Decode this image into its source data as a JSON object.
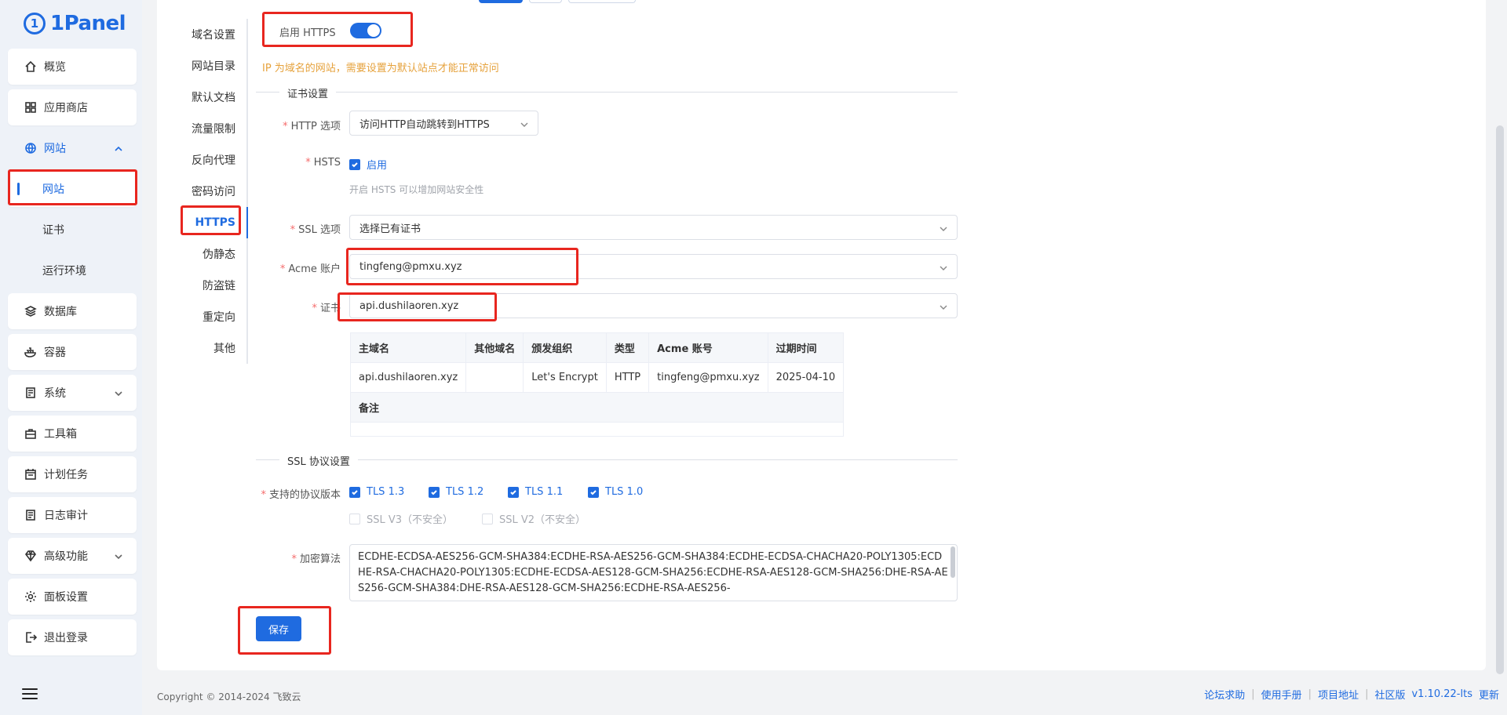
{
  "app": {
    "logo_text": "1Panel",
    "logo_mark": "1"
  },
  "sidebar": {
    "items": [
      {
        "label": "概览",
        "icon": "home-icon"
      },
      {
        "label": "应用商店",
        "icon": "grid-icon"
      },
      {
        "label": "网站",
        "icon": "globe-icon"
      },
      {
        "label": "网站"
      },
      {
        "label": "证书"
      },
      {
        "label": "运行环境"
      },
      {
        "label": "数据库",
        "icon": "layers-icon"
      },
      {
        "label": "容器",
        "icon": "docker-icon"
      },
      {
        "label": "系统",
        "icon": "server-icon"
      },
      {
        "label": "工具箱",
        "icon": "toolbox-icon"
      },
      {
        "label": "计划任务",
        "icon": "calendar-icon"
      },
      {
        "label": "日志审计",
        "icon": "log-icon"
      },
      {
        "label": "高级功能",
        "icon": "diamond-icon"
      },
      {
        "label": "面板设置",
        "icon": "gear-icon"
      },
      {
        "label": "退出登录",
        "icon": "logout-icon"
      }
    ]
  },
  "subnav": {
    "items": [
      "域名设置",
      "网站目录",
      "默认文档",
      "流量限制",
      "反向代理",
      "密码访问",
      "HTTPS",
      "伪静态",
      "防盗链",
      "重定向",
      "其他"
    ]
  },
  "https": {
    "enable_label": "启用 HTTPS",
    "ip_tip": "IP 为域名的网站，需要设置为默认站点才能正常访问",
    "cert_section": "证书设置",
    "http_option_label": "HTTP 选项",
    "http_option_value": "访问HTTP自动跳转到HTTPS",
    "hsts_label": "HSTS",
    "hsts_check": "启用",
    "hsts_hint": "开启 HSTS 可以增加网站安全性",
    "ssl_option_label": "SSL 选项",
    "ssl_option_value": "选择已有证书",
    "acme_label": "Acme 账户",
    "acme_value": "tingfeng@pmxu.xyz",
    "cert_label": "证书",
    "cert_value": "api.dushilaoren.xyz",
    "table": {
      "headers": [
        "主域名",
        "其他域名",
        "颁发组织",
        "类型",
        "Acme 账号",
        "过期时间"
      ],
      "row": [
        "api.dushilaoren.xyz",
        "",
        "Let's Encrypt",
        "HTTP",
        "tingfeng@pmxu.xyz",
        "2025-04-10"
      ],
      "remark_header": "备注",
      "remark_value": ""
    },
    "ssl_protocol_section": "SSL 协议设置",
    "protocols_label": "支持的协议版本",
    "protocols": [
      {
        "label": "TLS 1.3",
        "checked": true
      },
      {
        "label": "TLS 1.2",
        "checked": true
      },
      {
        "label": "TLS 1.1",
        "checked": true
      },
      {
        "label": "TLS 1.0",
        "checked": true
      },
      {
        "label": "SSL V3（不安全）",
        "checked": false
      },
      {
        "label": "SSL V2（不安全）",
        "checked": false
      }
    ],
    "cipher_label": "加密算法",
    "cipher_value": "ECDHE-ECDSA-AES256-GCM-SHA384:ECDHE-RSA-AES256-GCM-SHA384:ECDHE-ECDSA-CHACHA20-POLY1305:ECDHE-RSA-CHACHA20-POLY1305:ECDHE-ECDSA-AES128-GCM-SHA256:ECDHE-RSA-AES128-GCM-SHA256:DHE-RSA-AES256-GCM-SHA384:DHE-RSA-AES128-GCM-SHA256:ECDHE-RSA-AES256-",
    "save_label": "保存"
  },
  "footer": {
    "copyright": "Copyright © 2014-2024 飞致云",
    "links": [
      "论坛求助",
      "使用手册",
      "项目地址",
      "社区版"
    ],
    "version": "v1.10.22-lts",
    "update": "更新"
  },
  "colors": {
    "accent": "#1f6be0",
    "highlight": "#e8261f",
    "warning": "#e6a23c"
  }
}
